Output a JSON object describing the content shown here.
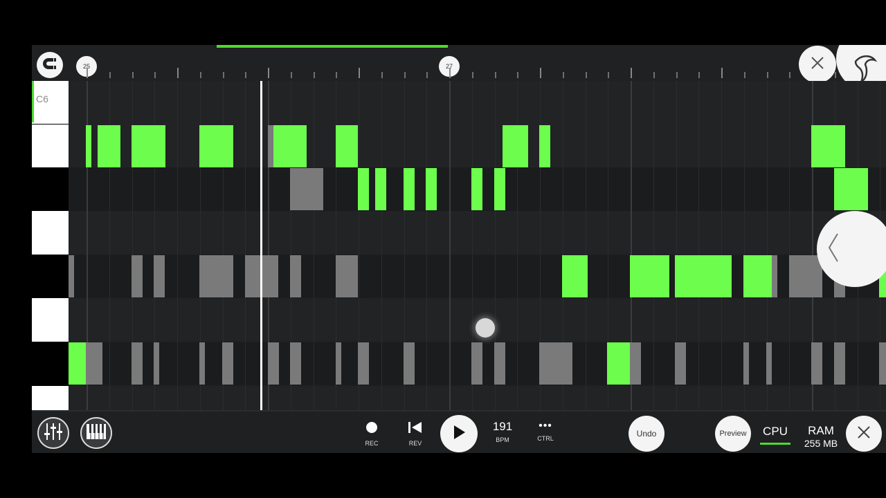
{
  "timeline": {
    "bar_markers": [
      {
        "label": "25"
      },
      {
        "label": "27"
      }
    ]
  },
  "piano": {
    "top_key_label": "C6"
  },
  "transport": {
    "rec_label": "REC",
    "rev_label": "REV",
    "bpm_value": "191",
    "bpm_label": "BPM",
    "ctrl_label": "CTRL",
    "ctrl_glyph": "•••",
    "undo_label": "Undo",
    "preview_label": "Preview"
  },
  "status": {
    "cpu_label": "CPU",
    "ram_label": "RAM",
    "ram_value": "255 MB"
  },
  "icons": [
    "magnet-icon",
    "close-icon",
    "fl-logo-icon",
    "chevron-left-icon",
    "mixer-icon",
    "piano-icon",
    "record-icon",
    "rewind-icon",
    "play-icon"
  ],
  "colors": {
    "note_green": "#6dfd4d",
    "note_gray": "#7a7a7a",
    "accent": "#4ddb2f"
  }
}
